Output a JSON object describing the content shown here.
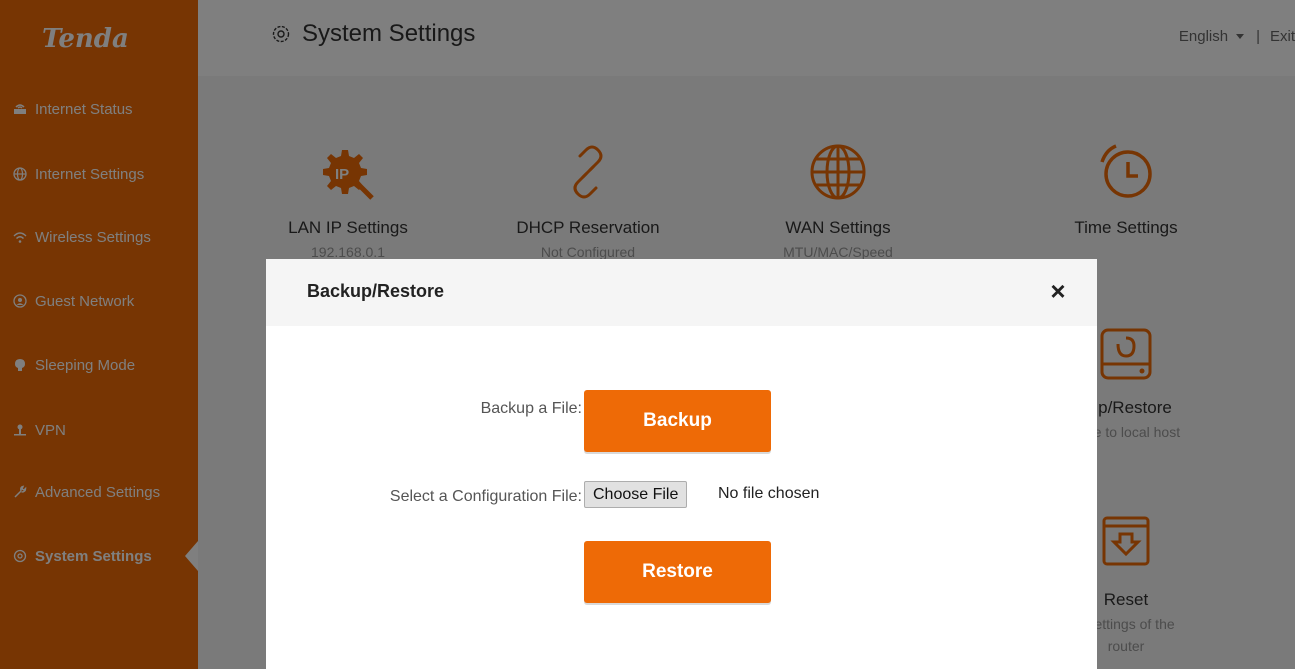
{
  "brand": {
    "logo": "Tenda",
    "accent": "#ee6a06"
  },
  "sidebar": {
    "items": [
      {
        "label": "Internet Status",
        "icon": "internet-status-icon"
      },
      {
        "label": "Internet Settings",
        "icon": "globe-icon"
      },
      {
        "label": "Wireless Settings",
        "icon": "wifi-icon"
      },
      {
        "label": "Guest Network",
        "icon": "guest-icon"
      },
      {
        "label": "Sleeping Mode",
        "icon": "sleep-icon"
      },
      {
        "label": "VPN",
        "icon": "vpn-icon"
      },
      {
        "label": "Advanced Settings",
        "icon": "wrench-icon"
      },
      {
        "label": "System Settings",
        "icon": "gear-icon",
        "active": true
      }
    ]
  },
  "header": {
    "title": "System Settings",
    "language": "English",
    "separator": "|",
    "exit": "Exit"
  },
  "tiles": [
    {
      "name": "LAN IP Settings",
      "sub": "192.168.0.1",
      "icon": "lan-ip-icon"
    },
    {
      "name": "DHCP Reservation",
      "sub": "Not Configured",
      "icon": "link-icon"
    },
    {
      "name": "WAN Settings",
      "sub": "MTU/MAC/Speed",
      "icon": "globe-icon"
    },
    {
      "name": "Time Settings",
      "sub": "",
      "icon": "clock-icon"
    },
    {
      "name": "kup/Restore",
      "sub": "a file to local host",
      "icon": "disk-restore-icon"
    },
    {
      "name": "Reset",
      "sub": "ll settings of the",
      "sub2": "router",
      "icon": "reset-box-icon"
    }
  ],
  "modal": {
    "title": "Backup/Restore",
    "close": "×",
    "backup_label": "Backup a File:",
    "backup_button": "Backup",
    "config_label": "Select a Configuration File:",
    "choose_button": "Choose File",
    "no_file": "No file chosen",
    "restore_button": "Restore"
  }
}
